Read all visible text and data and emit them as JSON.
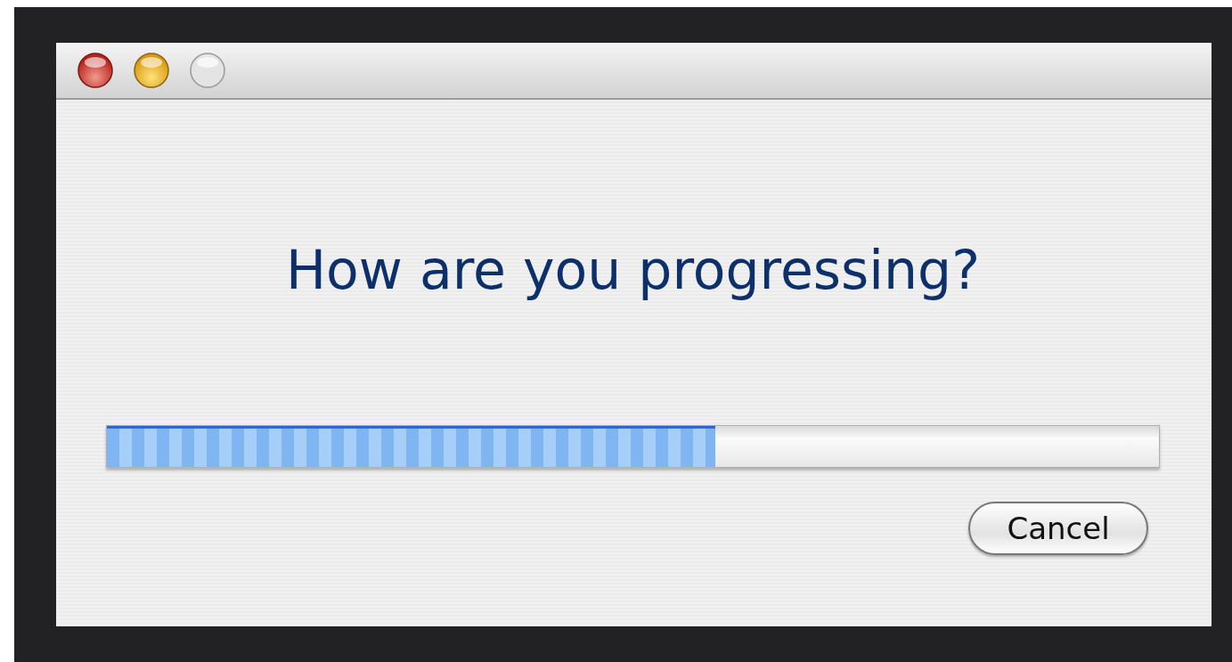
{
  "dialog": {
    "heading": "How are you progressing?",
    "progress": {
      "level": 0.578
    },
    "buttons": [
      "Cancel"
    ]
  }
}
